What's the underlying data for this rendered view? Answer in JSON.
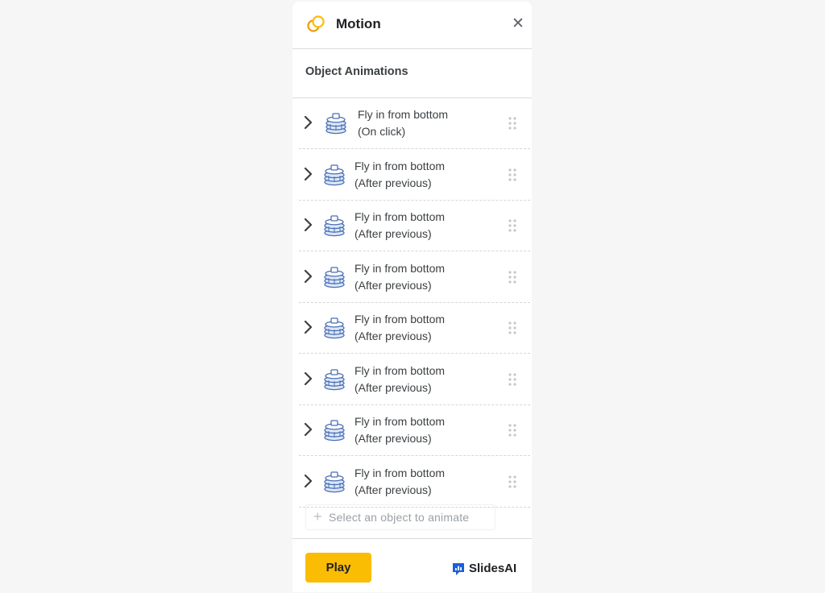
{
  "panel": {
    "title": "Motion",
    "close_icon": "close-icon",
    "section_title": "Object Animations"
  },
  "animations": [
    {
      "effect": "Fly in from bottom",
      "trigger": "(On click)"
    },
    {
      "effect": "Fly in from bottom",
      "trigger": "(After previous)"
    },
    {
      "effect": "Fly in from bottom",
      "trigger": "(After previous)"
    },
    {
      "effect": "Fly in from bottom",
      "trigger": "(After previous)"
    },
    {
      "effect": "Fly in from bottom",
      "trigger": "(After previous)"
    },
    {
      "effect": "Fly in from bottom",
      "trigger": "(After previous)"
    },
    {
      "effect": "Fly in from bottom",
      "trigger": "(After previous)"
    },
    {
      "effect": "Fly in from bottom",
      "trigger": "(After previous)"
    }
  ],
  "add_object": {
    "plus": "+",
    "label": "Select an object to animate"
  },
  "footer": {
    "play_label": "Play",
    "brand": "SlidesAI"
  },
  "colors": {
    "accent": "#fbbc04",
    "icon_blue": "#4a6fb5",
    "brand_blue": "#1a5fd6"
  }
}
